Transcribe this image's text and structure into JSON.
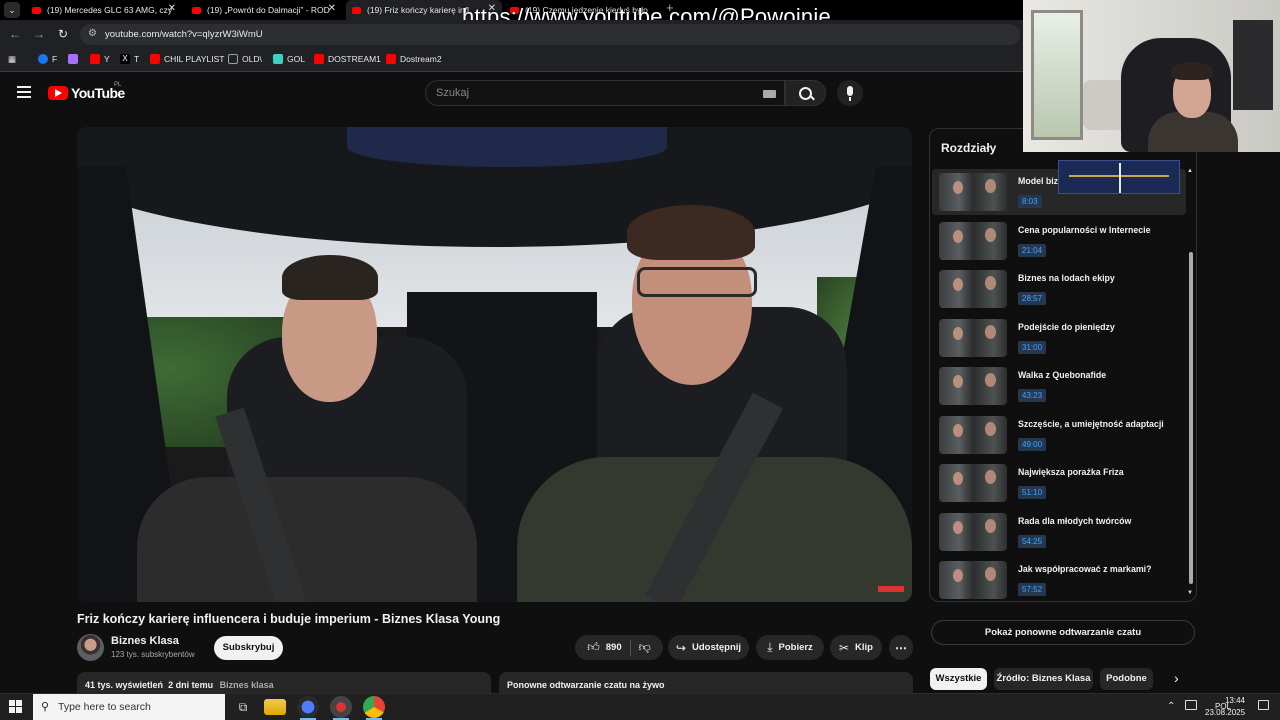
{
  "browser": {
    "tabs": [
      {
        "title": "(19) Mercedes GLC 63 AMG, czy",
        "close": "✕"
      },
      {
        "title": "(19) „Powrót do Dalmacji” - ROD",
        "close": "✕"
      },
      {
        "title": "(19) Friz kończy karierę infl",
        "close": "✕"
      },
      {
        "title": "(19) Czemu jedzenie kiedyś było",
        "close": "✕"
      }
    ],
    "new_tab": "+",
    "url": "youtube.com/watch?v=qlyzrW3iWmU",
    "overlay_url": "https://www.youtube.com/@Powojnie",
    "bookmarks": [
      {
        "label": "F",
        "color": "#1877f2"
      },
      {
        "label": "",
        "color": "#a970ff"
      },
      {
        "label": "Y",
        "color": "#ff0000"
      },
      {
        "label": "T",
        "color": "#000000"
      },
      {
        "label": "CHIL PLAYLIST",
        "color": "#ff0000"
      },
      {
        "label": "OLD\\",
        "color": "#9aa0a6"
      },
      {
        "label": "GOL",
        "color": "#3dd1c2"
      },
      {
        "label": "DOSTREAM1",
        "color": "#ff0000"
      },
      {
        "label": "Dostream2",
        "color": "#ff0000"
      }
    ]
  },
  "youtube": {
    "logo_text": "YouTube",
    "country_code": "PL",
    "search_placeholder": "Szukaj"
  },
  "video": {
    "title": "Friz kończy karierę influencera i buduje imperium - Biznes Klasa Young",
    "channel_name": "Biznes Klasa",
    "subscribers": "123 tys. subskrybentów",
    "subscribe_label": "Subskrybuj",
    "likes": "890",
    "share_label": "Udostępnij",
    "download_label": "Pobierz",
    "clip_label": "Klip",
    "more_label": "⋯",
    "views": "41 tys. wyświetleń",
    "age": "2 dni temu",
    "tag": "Biznes klasa",
    "replay_label": "Ponowne odtwarzanie czatu na żywo"
  },
  "chapters": {
    "title": "Rozdziały",
    "items": [
      {
        "title": "Model biz",
        "time": "8:03"
      },
      {
        "title": "Cena popularności w Internecie",
        "time": "21:04"
      },
      {
        "title": "Biznes na lodach ekipy",
        "time": "28:57"
      },
      {
        "title": "Podejście do pieniędzy",
        "time": "31:00"
      },
      {
        "title": "Walka z Quebonafide",
        "time": "43:23"
      },
      {
        "title": "Szczęście, a umiejętność adaptacji",
        "time": "49:00"
      },
      {
        "title": "Największa porażka Friza",
        "time": "51:10"
      },
      {
        "title": "Rada dla młodych twórców",
        "time": "54:25"
      },
      {
        "title": "Jak współpracować z markami?",
        "time": "57:52"
      }
    ]
  },
  "sidebar": {
    "show_chat": "Pokaż ponowne odtwarzanie czatu",
    "chips": [
      "Wszystkie",
      "Źródło: Biznes Klasa",
      "Podobne"
    ]
  },
  "taskbar": {
    "search_placeholder": "Type here to search",
    "language": "POL",
    "time": "13:44",
    "date": "23.08.2025"
  },
  "colors": {
    "youtube_red": "#ff0000",
    "chapter_time_text": "#3ea6ff",
    "page_bg": "#0f0f0f"
  }
}
